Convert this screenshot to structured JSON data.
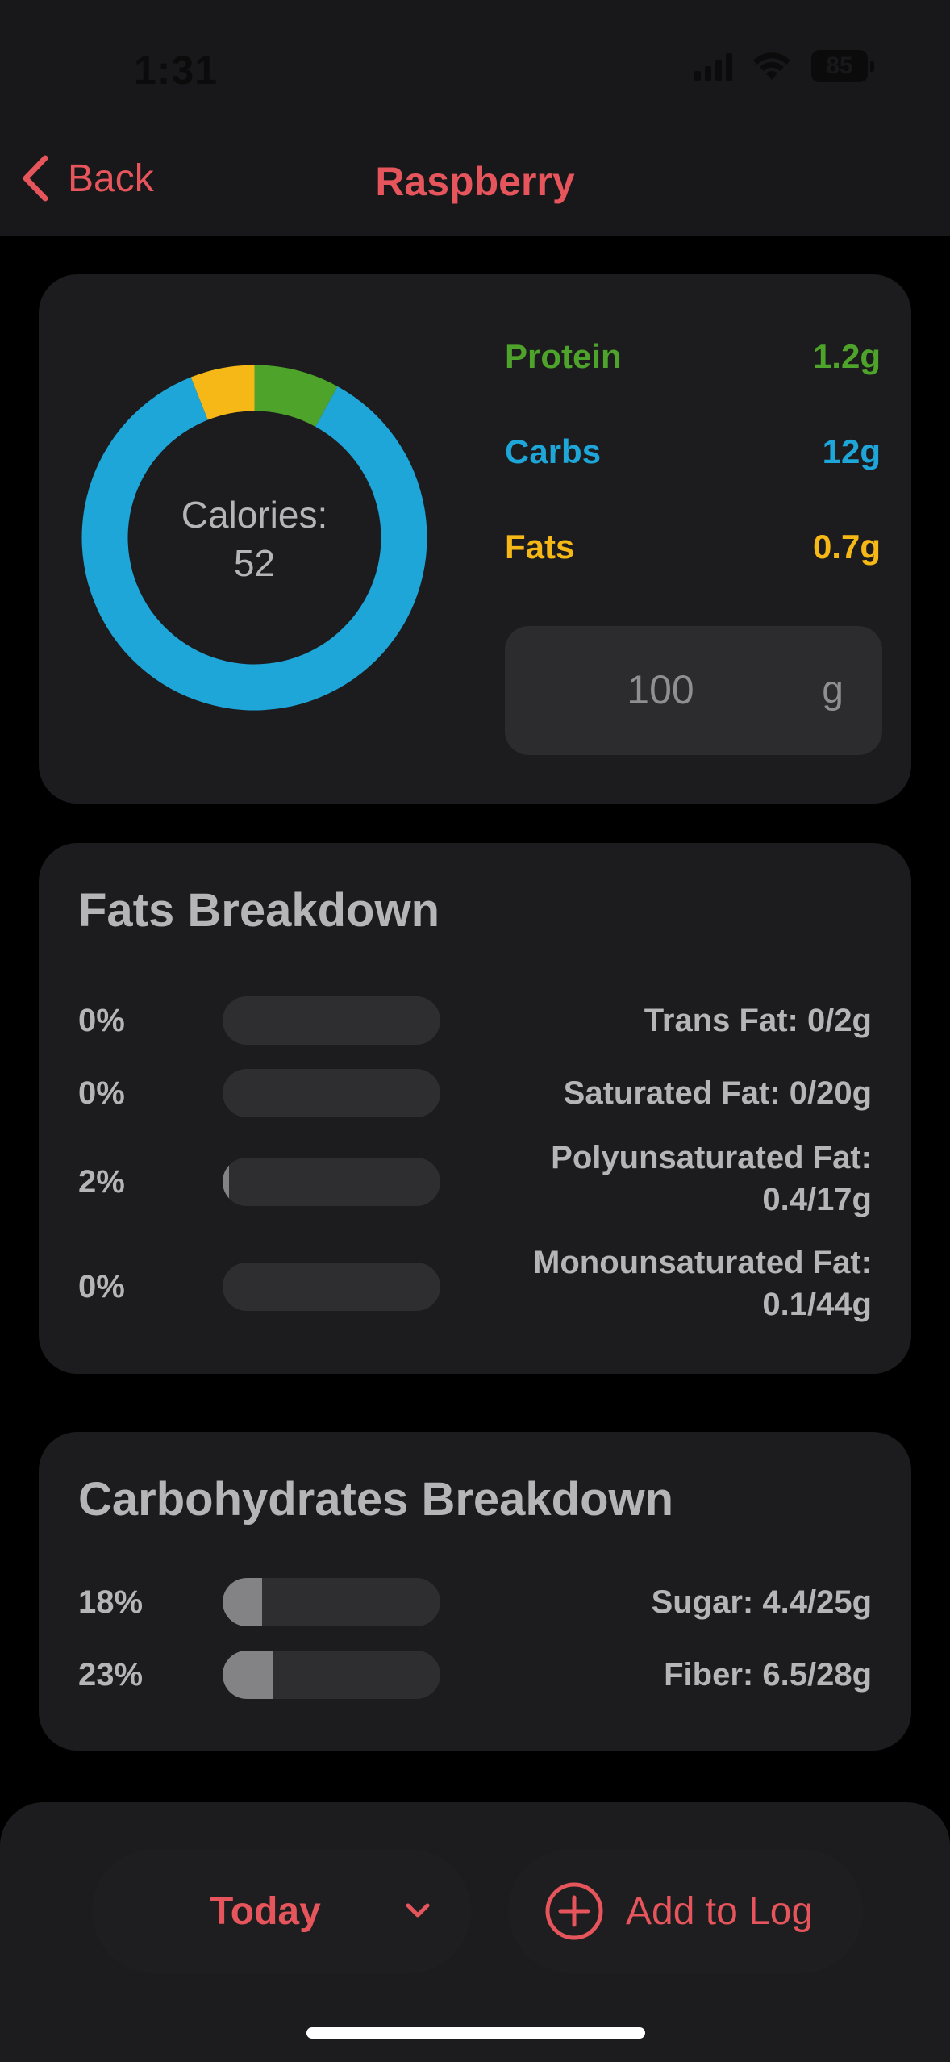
{
  "status_bar": {
    "time": "1:31",
    "battery": "85"
  },
  "nav": {
    "back_label": "Back",
    "title": "Raspberry"
  },
  "summary": {
    "calories_label": "Calories:",
    "calories_value": "52",
    "macros": [
      {
        "name": "Protein",
        "value": "1.2g",
        "color": "#4ea32a"
      },
      {
        "name": "Carbs",
        "value": "12g",
        "color": "#1ea6d9"
      },
      {
        "name": "Fats",
        "value": "0.7g",
        "color": "#f6b817"
      }
    ],
    "quantity": {
      "value": "100",
      "unit": "g"
    }
  },
  "chart_data": {
    "type": "pie",
    "categories": [
      "Carbs",
      "Fats",
      "Protein"
    ],
    "values": [
      0.86,
      0.06,
      0.08
    ],
    "colors": [
      "#1ea6d9",
      "#f6b817",
      "#4ea32a"
    ]
  },
  "fats_breakdown": {
    "title": "Fats Breakdown",
    "rows": [
      {
        "percent": "0%",
        "fraction": 0.0,
        "label": "Trans Fat: 0/2g"
      },
      {
        "percent": "0%",
        "fraction": 0.0,
        "label": "Saturated Fat: 0/20g"
      },
      {
        "percent": "2%",
        "fraction": 0.02,
        "label": "Polyunsaturated Fat: 0.4/17g"
      },
      {
        "percent": "0%",
        "fraction": 0.0,
        "label": "Monounsaturated Fat: 0.1/44g"
      }
    ]
  },
  "carbs_breakdown": {
    "title": "Carbohydrates Breakdown",
    "rows": [
      {
        "percent": "18%",
        "fraction": 0.18,
        "label": "Sugar: 4.4/25g"
      },
      {
        "percent": "23%",
        "fraction": 0.23,
        "label": "Fiber: 6.5/28g"
      }
    ]
  },
  "bottom": {
    "day_label": "Today",
    "add_label": "Add to Log"
  },
  "colors": {
    "accent": "#e5555b"
  }
}
